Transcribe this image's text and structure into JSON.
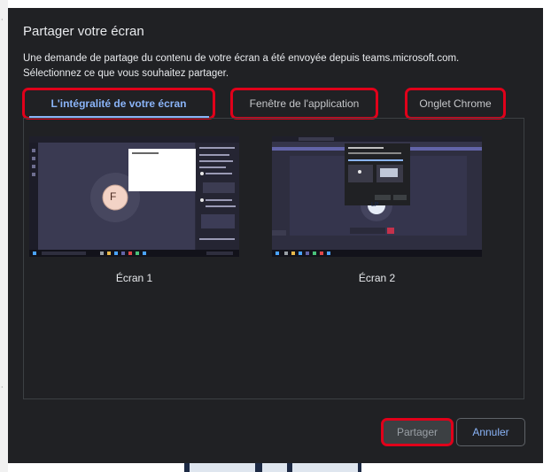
{
  "dialog": {
    "title": "Partager votre écran",
    "description": "Une demande de partage du contenu de votre écran a été envoyée depuis teams.microsoft.com. Sélectionnez ce que vous souhaitez partager."
  },
  "tabs": [
    {
      "label": "L'intégralité de votre écran",
      "active": true
    },
    {
      "label": "Fenêtre de l'application",
      "active": false
    },
    {
      "label": "Onglet Chrome",
      "active": false
    }
  ],
  "screens": [
    {
      "label": "Écran 1",
      "avatar_initial": "F"
    },
    {
      "label": "Écran 2",
      "avatar_initial": "LP"
    }
  ],
  "buttons": {
    "share_label": "Partager",
    "cancel_label": "Annuler"
  },
  "colors": {
    "dialog_bg": "#202124",
    "accent": "#8ab4f8",
    "highlight": "#e0001a"
  }
}
